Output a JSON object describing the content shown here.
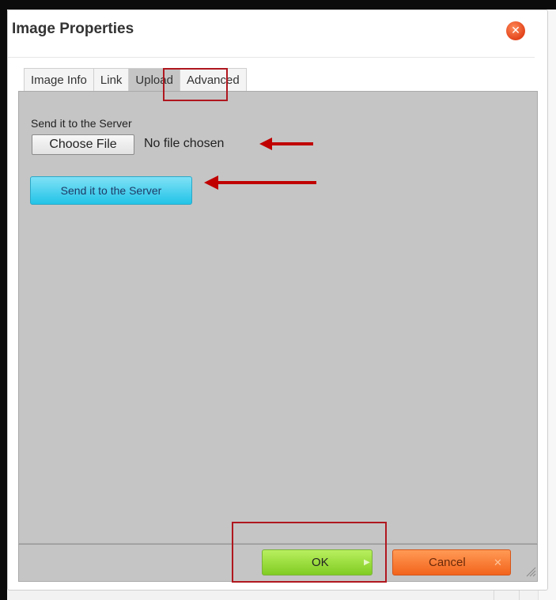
{
  "dialog": {
    "title": "Image Properties",
    "close_icon": "close-icon"
  },
  "tabs": [
    {
      "label": "Image Info",
      "active": false
    },
    {
      "label": "Link",
      "active": false
    },
    {
      "label": "Upload",
      "active": true
    },
    {
      "label": "Advanced",
      "active": false
    }
  ],
  "upload": {
    "section_label": "Send it to the Server",
    "choose_file_label": "Choose File",
    "file_status": "No file chosen",
    "send_button_label": "Send it to the Server"
  },
  "footer": {
    "ok_label": "OK",
    "ok_icon": "chevron-right-icon",
    "cancel_label": "Cancel",
    "cancel_icon": "close-x-icon"
  },
  "annotations": {
    "highlight_color": "#b0171f",
    "arrow_color": "#c00000"
  },
  "colors": {
    "panel_bg": "#c5c5c5",
    "ok_green": "#8fd23a",
    "cancel_orange": "#f36a22",
    "send_cyan": "#2cc6e8"
  }
}
